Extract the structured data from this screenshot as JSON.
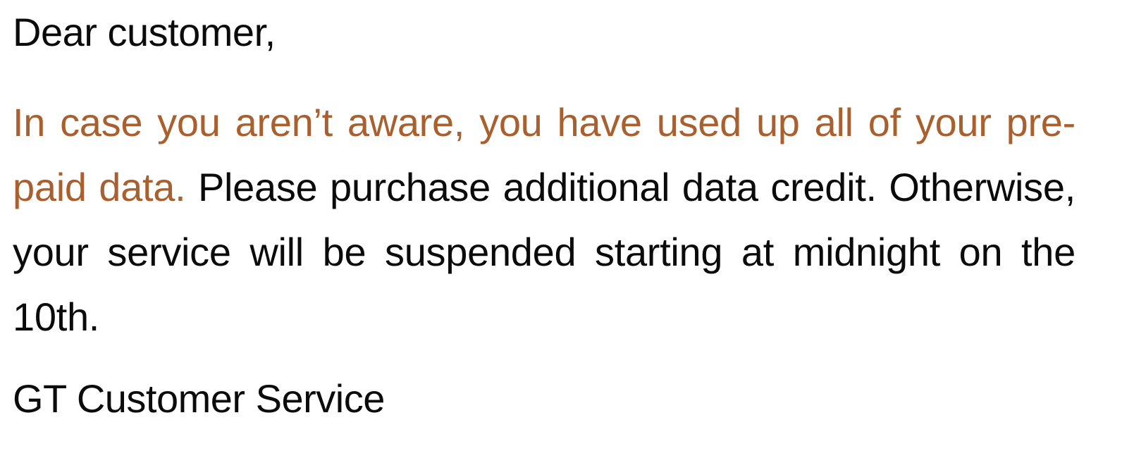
{
  "message": {
    "greeting": "Dear customer,",
    "highlight": "In case you aren’t aware, you have used up all of your pre-paid data.",
    "body": " Please purchase additional data credit. Otherwise, your service will be suspended starting at midnight on the 10th.",
    "signature": "GT Customer Service"
  },
  "colors": {
    "text": "#0b0b0b",
    "highlight": "#a95f2e"
  }
}
